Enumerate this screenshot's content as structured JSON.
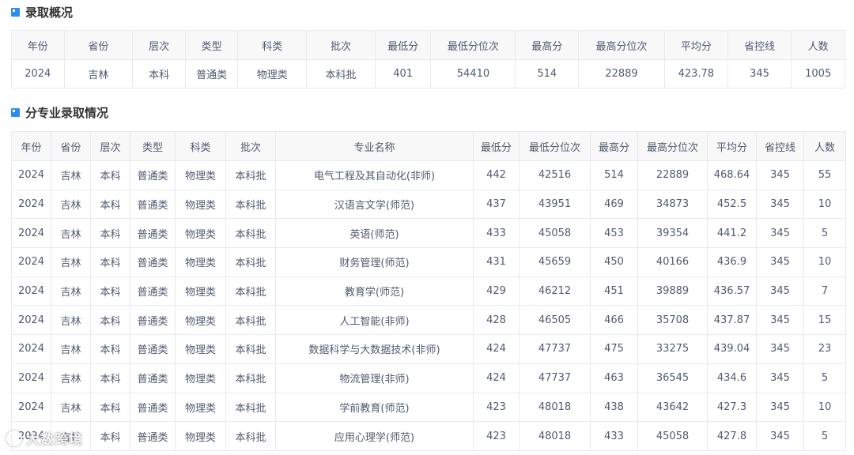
{
  "summary": {
    "title": "录取概况",
    "headers": [
      "年份",
      "省份",
      "层次",
      "类型",
      "科类",
      "批次",
      "最低分",
      "最低分位次",
      "最高分",
      "最高分位次",
      "平均分",
      "省控线",
      "人数"
    ],
    "row": [
      "2024",
      "吉林",
      "本科",
      "普通类",
      "物理类",
      "本科批",
      "401",
      "54410",
      "514",
      "22889",
      "423.78",
      "345",
      "1005"
    ]
  },
  "majors": {
    "title": "分专业录取情况",
    "headers": [
      "年份",
      "省份",
      "层次",
      "类型",
      "科类",
      "批次",
      "专业名称",
      "最低分",
      "最低分位次",
      "最高分",
      "最高分位次",
      "平均分",
      "省控线",
      "人数"
    ],
    "rows": [
      [
        "2024",
        "吉林",
        "本科",
        "普通类",
        "物理类",
        "本科批",
        "电气工程及其自动化(非师)",
        "442",
        "42516",
        "514",
        "22889",
        "468.64",
        "345",
        "55"
      ],
      [
        "2024",
        "吉林",
        "本科",
        "普通类",
        "物理类",
        "本科批",
        "汉语言文学(师范)",
        "437",
        "43951",
        "469",
        "34873",
        "452.5",
        "345",
        "10"
      ],
      [
        "2024",
        "吉林",
        "本科",
        "普通类",
        "物理类",
        "本科批",
        "英语(师范)",
        "433",
        "45058",
        "453",
        "39354",
        "441.2",
        "345",
        "5"
      ],
      [
        "2024",
        "吉林",
        "本科",
        "普通类",
        "物理类",
        "本科批",
        "财务管理(师范)",
        "431",
        "45659",
        "450",
        "40166",
        "436.9",
        "345",
        "10"
      ],
      [
        "2024",
        "吉林",
        "本科",
        "普通类",
        "物理类",
        "本科批",
        "教育学(师范)",
        "429",
        "46212",
        "451",
        "39889",
        "436.57",
        "345",
        "7"
      ],
      [
        "2024",
        "吉林",
        "本科",
        "普通类",
        "物理类",
        "本科批",
        "人工智能(非师)",
        "428",
        "46505",
        "466",
        "35708",
        "437.87",
        "345",
        "15"
      ],
      [
        "2024",
        "吉林",
        "本科",
        "普通类",
        "物理类",
        "本科批",
        "数据科学与大数据技术(非师)",
        "424",
        "47737",
        "475",
        "33275",
        "439.04",
        "345",
        "23"
      ],
      [
        "2024",
        "吉林",
        "本科",
        "普通类",
        "物理类",
        "本科批",
        "物流管理(非师)",
        "424",
        "47737",
        "463",
        "36545",
        "434.6",
        "345",
        "5"
      ],
      [
        "2024",
        "吉林",
        "本科",
        "普通类",
        "物理类",
        "本科批",
        "学前教育(师范)",
        "423",
        "48018",
        "438",
        "43642",
        "427.3",
        "345",
        "10"
      ],
      [
        "2024",
        "吉林",
        "本科",
        "普通类",
        "物理类",
        "本科批",
        "应用心理学(师范)",
        "423",
        "48018",
        "433",
        "45058",
        "427.8",
        "345",
        "5"
      ]
    ]
  },
  "watermark": "大数跨境",
  "colors": {
    "accent": "#2d8cf0",
    "header_bg": "#f8f8f9",
    "border": "#e8eaec"
  },
  "icons": {
    "section": "section-bookmark-icon"
  }
}
